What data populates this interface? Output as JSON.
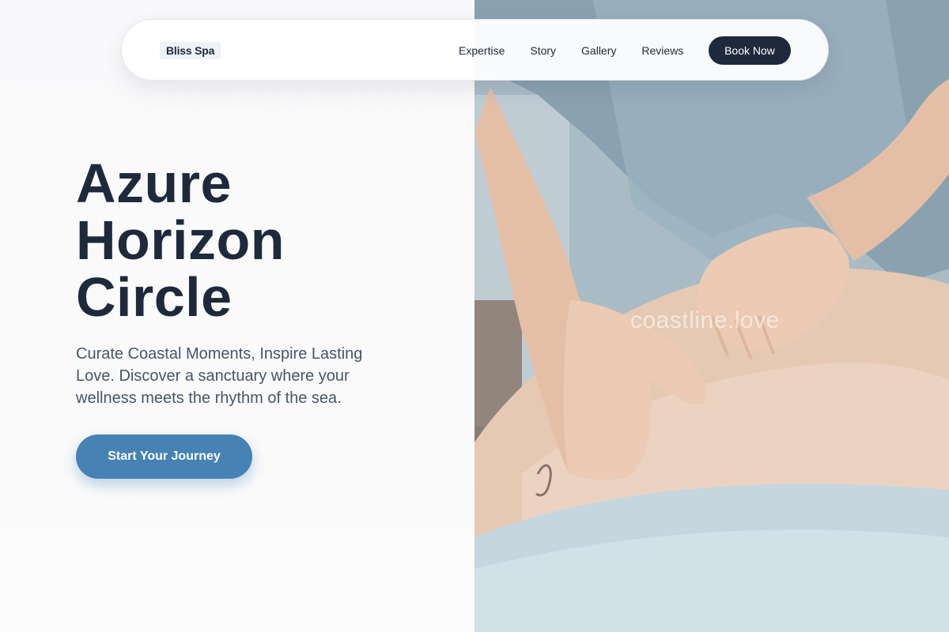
{
  "nav": {
    "logo": "Bliss Spa",
    "links": [
      "Expertise",
      "Story",
      "Gallery",
      "Reviews"
    ],
    "book_label": "Book Now"
  },
  "hero": {
    "title_lines": [
      "Azure",
      "Horizon",
      "Circle"
    ],
    "subtitle": "Curate Coastal Moments, Inspire Lasting Love. Discover a sanctuary where your wellness meets the rhythm of the sea.",
    "cta_label": "Start Your Journey"
  },
  "image": {
    "watermark": "coastline.love"
  },
  "colors": {
    "primary_dark": "#1e293b",
    "accent_blue": "#4682b4",
    "text_muted": "#475569",
    "background": "#fafafa"
  }
}
